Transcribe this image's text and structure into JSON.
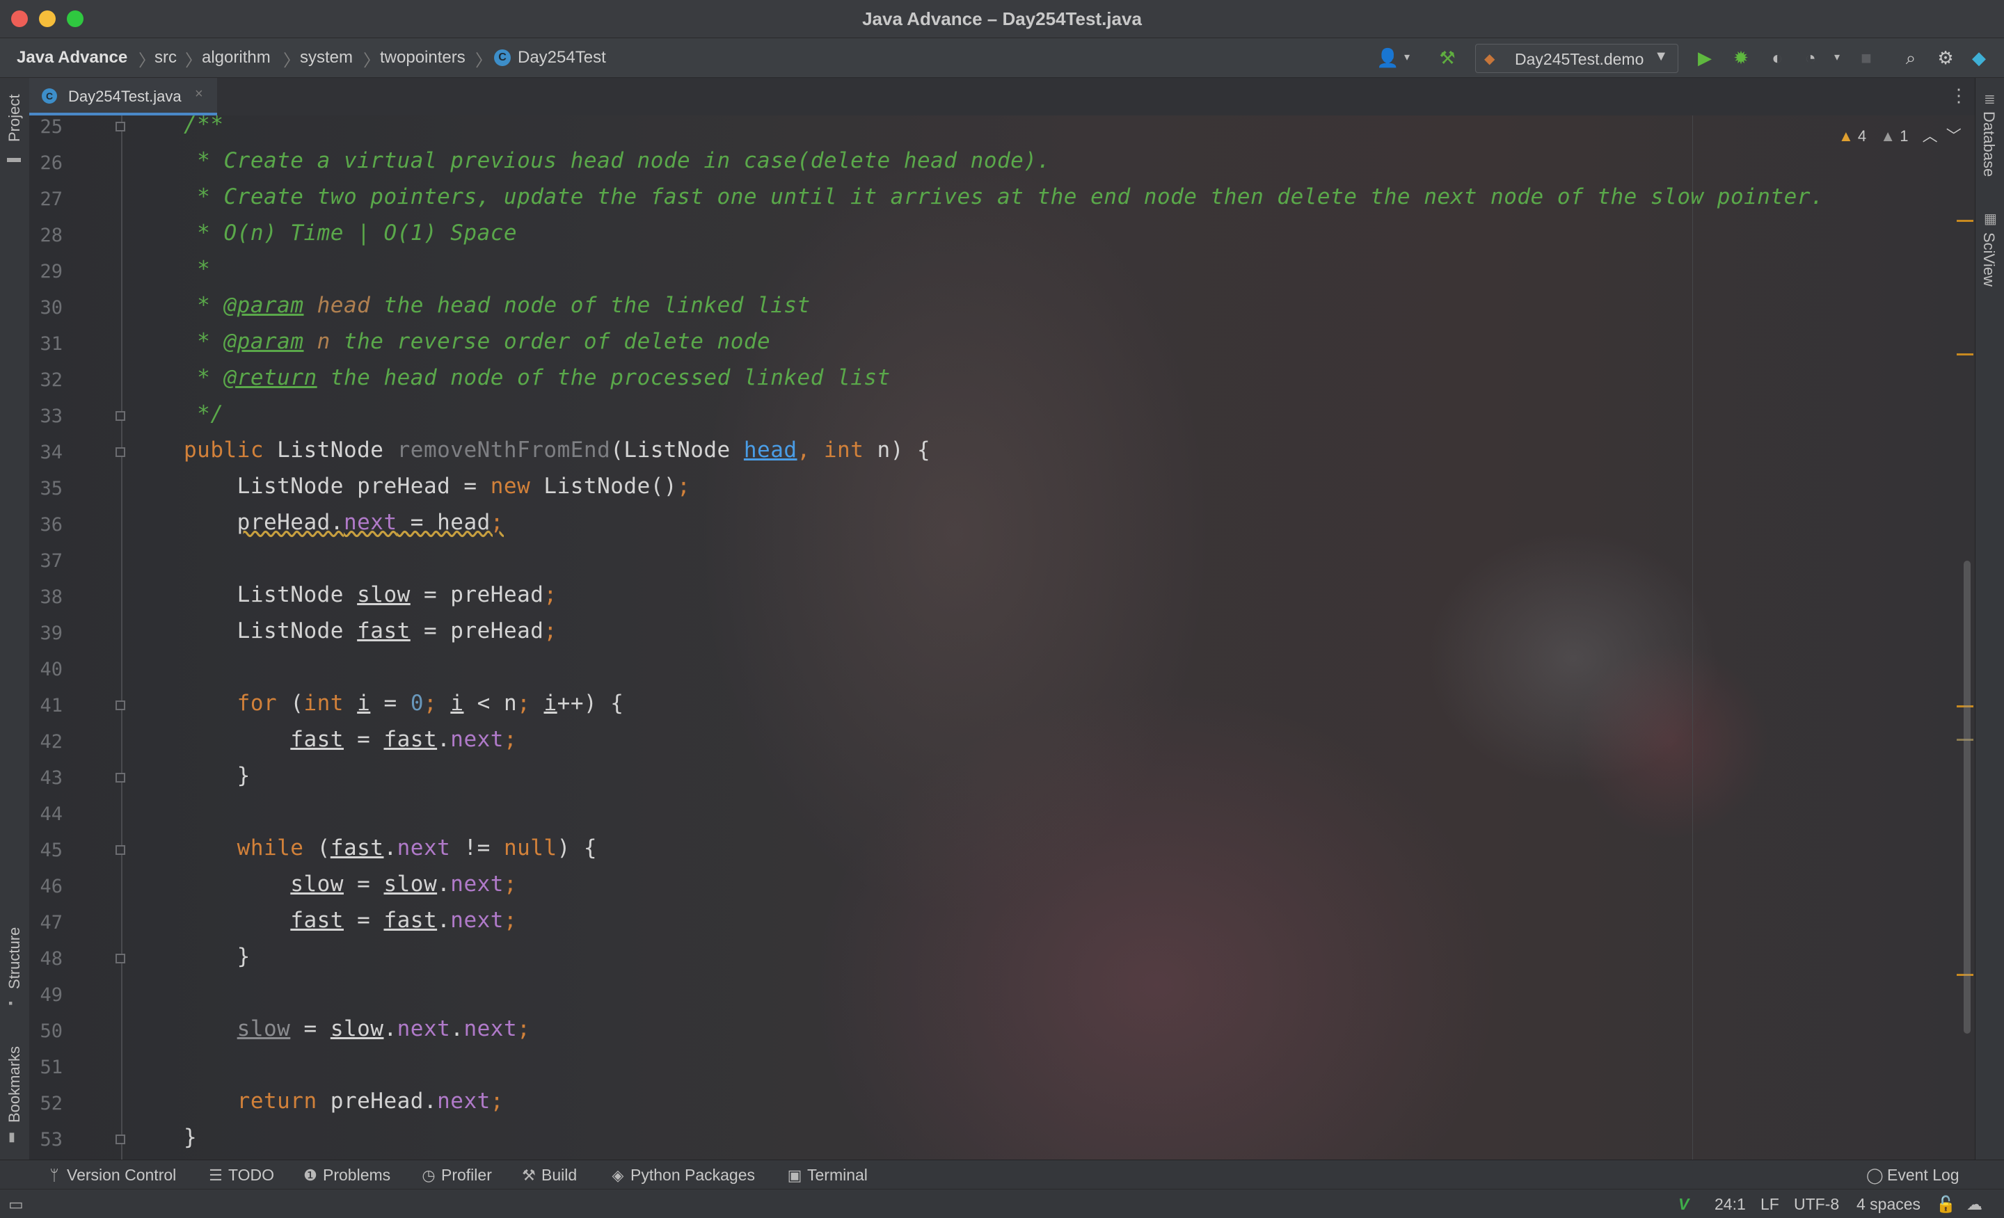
{
  "window": {
    "title": "Java Advance – Day254Test.java",
    "colors": {
      "close": "#ee5f57",
      "minimize": "#f6be3b",
      "maximize": "#2fc840"
    }
  },
  "breadcrumbs": [
    "Java Advance",
    "src",
    "algorithm",
    "system",
    "twopointers",
    "Day254Test"
  ],
  "navbar": {
    "run_config": "Day245Test.demo",
    "icons": [
      "user-icon",
      "hammer-icon",
      "run-icon",
      "debug-icon",
      "coverage-icon",
      "profile-icon",
      "stop-icon",
      "search-icon",
      "gear-icon",
      "plugin-icon"
    ]
  },
  "tab": {
    "label": "Day254Test.java"
  },
  "side_panels": {
    "left_top": "Project",
    "left_mid": "Structure",
    "left_bottom": "Bookmarks",
    "right_top": "Database",
    "right_mid": "SciView"
  },
  "inspections": {
    "warnings": "4",
    "weak_warnings": "1"
  },
  "editor": {
    "lines": [
      {
        "n": "25",
        "segs": [
          {
            "t": "/**",
            "c": "cmt"
          }
        ]
      },
      {
        "n": "26",
        "segs": [
          {
            "t": " * Create a virtual previous head node in case(delete head node).",
            "c": "cmt"
          }
        ]
      },
      {
        "n": "27",
        "segs": [
          {
            "t": " * Create two pointers, update the fast one until it arrives at the end node then delete the next node of the slow pointer.",
            "c": "cmt"
          }
        ]
      },
      {
        "n": "28",
        "segs": [
          {
            "t": " * O(n) Time | O(1) Space",
            "c": "cmt"
          }
        ]
      },
      {
        "n": "29",
        "segs": [
          {
            "t": " *",
            "c": "cmt"
          }
        ]
      },
      {
        "n": "30",
        "segs": [
          {
            "t": " * ",
            "c": "cmt"
          },
          {
            "t": "@param",
            "c": "tag"
          },
          {
            "t": " head",
            "c": "pname"
          },
          {
            "t": " the head node of the linked list",
            "c": "cmt"
          }
        ]
      },
      {
        "n": "31",
        "segs": [
          {
            "t": " * ",
            "c": "cmt"
          },
          {
            "t": "@param",
            "c": "tag"
          },
          {
            "t": " n",
            "c": "pname"
          },
          {
            "t": " the reverse order of delete node",
            "c": "cmt"
          }
        ]
      },
      {
        "n": "32",
        "segs": [
          {
            "t": " * ",
            "c": "cmt"
          },
          {
            "t": "@return",
            "c": "tag"
          },
          {
            "t": " the head node of the processed linked list",
            "c": "cmt"
          }
        ]
      },
      {
        "n": "33",
        "segs": [
          {
            "t": " */",
            "c": "cmt"
          }
        ]
      },
      {
        "n": "34",
        "segs": [
          {
            "t": "public",
            "c": "kw"
          },
          {
            "t": " ListNode ",
            "c": ""
          },
          {
            "t": "removeNthFromEnd",
            "c": "dim"
          },
          {
            "t": "(ListNode ",
            "c": ""
          },
          {
            "t": "head",
            "c": "lnk"
          },
          {
            "t": ", ",
            "c": "kw"
          },
          {
            "t": "int",
            "c": "kw"
          },
          {
            "t": " n) {",
            "c": ""
          }
        ]
      },
      {
        "n": "35",
        "segs": [
          {
            "t": "    ListNode preHead = ",
            "c": ""
          },
          {
            "t": "new",
            "c": "kw"
          },
          {
            "t": " ListNode()",
            "c": ""
          },
          {
            "t": ";",
            "c": "kw"
          }
        ]
      },
      {
        "n": "36",
        "segs": [
          {
            "t": "    ",
            "c": ""
          },
          {
            "t": "preHead.",
            "c": "warnwave"
          },
          {
            "t": "next",
            "c": "fld warnwave"
          },
          {
            "t": " = head",
            "c": "warnwave"
          },
          {
            "t": ";",
            "c": "kw warnwave"
          }
        ]
      },
      {
        "n": "37",
        "segs": []
      },
      {
        "n": "38",
        "segs": [
          {
            "t": "    ListNode ",
            "c": ""
          },
          {
            "t": "slow",
            "c": "ul"
          },
          {
            "t": " = preHead",
            "c": ""
          },
          {
            "t": ";",
            "c": "kw"
          }
        ]
      },
      {
        "n": "39",
        "segs": [
          {
            "t": "    ListNode ",
            "c": ""
          },
          {
            "t": "fast",
            "c": "ul"
          },
          {
            "t": " = preHead",
            "c": ""
          },
          {
            "t": ";",
            "c": "kw"
          }
        ]
      },
      {
        "n": "40",
        "segs": []
      },
      {
        "n": "41",
        "segs": [
          {
            "t": "    ",
            "c": ""
          },
          {
            "t": "for",
            "c": "kw"
          },
          {
            "t": " (",
            "c": ""
          },
          {
            "t": "int",
            "c": "kw"
          },
          {
            "t": " ",
            "c": ""
          },
          {
            "t": "i",
            "c": "ul"
          },
          {
            "t": " = ",
            "c": ""
          },
          {
            "t": "0",
            "c": "num"
          },
          {
            "t": "; ",
            "c": "kw"
          },
          {
            "t": "i",
            "c": "ul"
          },
          {
            "t": " < n",
            "c": ""
          },
          {
            "t": "; ",
            "c": "kw"
          },
          {
            "t": "i",
            "c": "ul"
          },
          {
            "t": "++) {",
            "c": ""
          }
        ]
      },
      {
        "n": "42",
        "segs": [
          {
            "t": "        ",
            "c": ""
          },
          {
            "t": "fast",
            "c": "ul"
          },
          {
            "t": " = ",
            "c": ""
          },
          {
            "t": "fast",
            "c": "ul"
          },
          {
            "t": ".",
            "c": ""
          },
          {
            "t": "next",
            "c": "fld"
          },
          {
            "t": ";",
            "c": "kw"
          }
        ]
      },
      {
        "n": "43",
        "segs": [
          {
            "t": "    }",
            "c": ""
          }
        ]
      },
      {
        "n": "44",
        "segs": []
      },
      {
        "n": "45",
        "segs": [
          {
            "t": "    ",
            "c": ""
          },
          {
            "t": "while",
            "c": "kw"
          },
          {
            "t": " (",
            "c": ""
          },
          {
            "t": "fast",
            "c": "ul"
          },
          {
            "t": ".",
            "c": ""
          },
          {
            "t": "next",
            "c": "fld"
          },
          {
            "t": " != ",
            "c": ""
          },
          {
            "t": "null",
            "c": "kw"
          },
          {
            "t": ") {",
            "c": ""
          }
        ]
      },
      {
        "n": "46",
        "segs": [
          {
            "t": "        ",
            "c": ""
          },
          {
            "t": "slow",
            "c": "ul"
          },
          {
            "t": " = ",
            "c": ""
          },
          {
            "t": "slow",
            "c": "ul"
          },
          {
            "t": ".",
            "c": ""
          },
          {
            "t": "next",
            "c": "fld"
          },
          {
            "t": ";",
            "c": "kw"
          }
        ]
      },
      {
        "n": "47",
        "segs": [
          {
            "t": "        ",
            "c": ""
          },
          {
            "t": "fast",
            "c": "ul"
          },
          {
            "t": " = ",
            "c": ""
          },
          {
            "t": "fast",
            "c": "ul"
          },
          {
            "t": ".",
            "c": ""
          },
          {
            "t": "next",
            "c": "fld"
          },
          {
            "t": ";",
            "c": "kw"
          }
        ]
      },
      {
        "n": "48",
        "segs": [
          {
            "t": "    }",
            "c": ""
          }
        ]
      },
      {
        "n": "49",
        "segs": []
      },
      {
        "n": "50",
        "segs": [
          {
            "t": "    ",
            "c": ""
          },
          {
            "t": "slow",
            "c": "dimul"
          },
          {
            "t": " = ",
            "c": ""
          },
          {
            "t": "slow",
            "c": "ul"
          },
          {
            "t": ".",
            "c": ""
          },
          {
            "t": "next",
            "c": "fld"
          },
          {
            "t": ".",
            "c": ""
          },
          {
            "t": "next",
            "c": "fld"
          },
          {
            "t": ";",
            "c": "kw"
          }
        ]
      },
      {
        "n": "51",
        "segs": []
      },
      {
        "n": "52",
        "segs": [
          {
            "t": "    ",
            "c": ""
          },
          {
            "t": "return",
            "c": "kw"
          },
          {
            "t": " preHead.",
            "c": ""
          },
          {
            "t": "next",
            "c": "fld"
          },
          {
            "t": ";",
            "c": "kw"
          }
        ]
      },
      {
        "n": "53",
        "segs": [
          {
            "t": "}",
            "c": ""
          }
        ]
      }
    ]
  },
  "tool_windows": [
    "Version Control",
    "TODO",
    "Problems",
    "Profiler",
    "Build",
    "Python Packages",
    "Terminal"
  ],
  "event_log": "Event Log",
  "status": {
    "position": "24:1",
    "line_sep": "LF",
    "encoding": "UTF-8",
    "indent": "4 spaces"
  }
}
